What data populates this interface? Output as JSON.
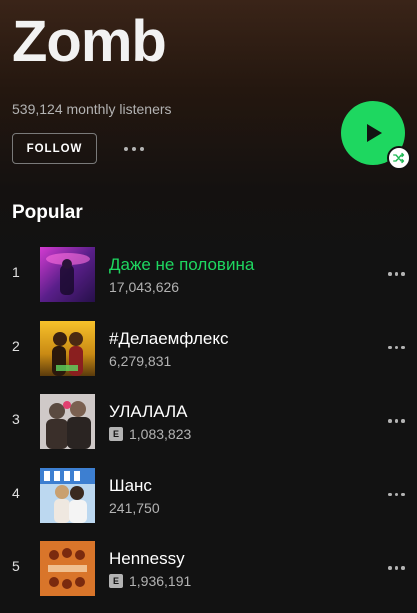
{
  "artist": {
    "name": "Zomb",
    "monthly_listeners": "539,124 monthly listeners"
  },
  "actions": {
    "follow_label": "FOLLOW",
    "more_icon": "ellipsis-icon",
    "play_icon": "play-icon",
    "shuffle_icon": "shuffle-icon",
    "accent_color": "#1ed760"
  },
  "popular": {
    "title": "Popular",
    "tracks": [
      {
        "number": "1",
        "title": "Даже не половина",
        "plays": "17,043,626",
        "explicit": false,
        "playing": true
      },
      {
        "number": "2",
        "title": "#Делаемфлекс",
        "plays": "6,279,831",
        "explicit": false,
        "playing": false
      },
      {
        "number": "3",
        "title": "УЛАЛАЛА",
        "plays": "1,083,823",
        "explicit": true,
        "playing": false
      },
      {
        "number": "4",
        "title": "Шанс",
        "plays": "241,750",
        "explicit": false,
        "playing": false
      },
      {
        "number": "5",
        "title": "Hennessy",
        "plays": "1,936,191",
        "explicit": true,
        "playing": false
      }
    ],
    "explicit_label": "E"
  }
}
